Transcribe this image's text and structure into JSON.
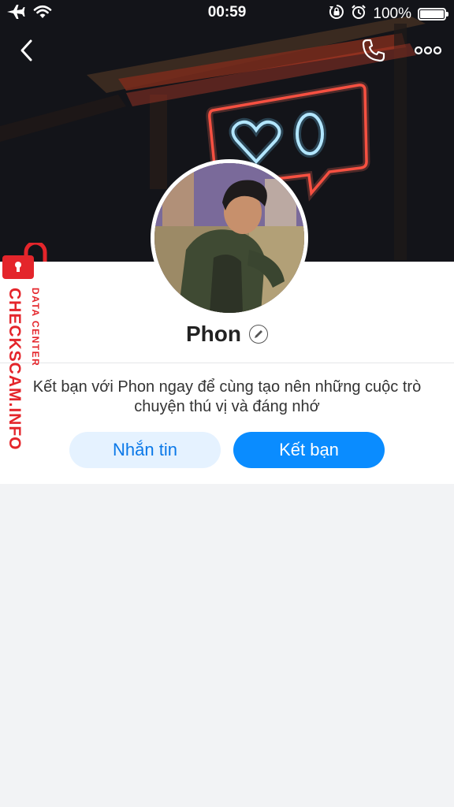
{
  "status_bar": {
    "time": "00:59",
    "battery": "100%",
    "battery_level": 1.0,
    "icons": [
      "airplane-icon",
      "wifi-icon",
      "rotation-lock-icon",
      "alarm-icon",
      "battery-icon"
    ]
  },
  "nav": {
    "icons": [
      "back-icon",
      "phone-icon",
      "more-icon"
    ]
  },
  "profile": {
    "name": "Phon",
    "invite_text": "Kết bạn với Phon ngay để cùng tạo nên những cuộc trò chuyện thú vị và đáng nhớ",
    "message_button": "Nhắn tin",
    "add_friend_button": "Kết bạn"
  },
  "watermark": {
    "main": "CHECKSCAM.INFO",
    "sub": "DATA CENTER"
  },
  "colors": {
    "accent": "#0a8cff",
    "accent_light": "#e5f2ff",
    "background": "#f2f3f5",
    "watermark": "#e4252b",
    "neon_red": "#ff3b30",
    "neon_blue": "#b5e6ff"
  }
}
